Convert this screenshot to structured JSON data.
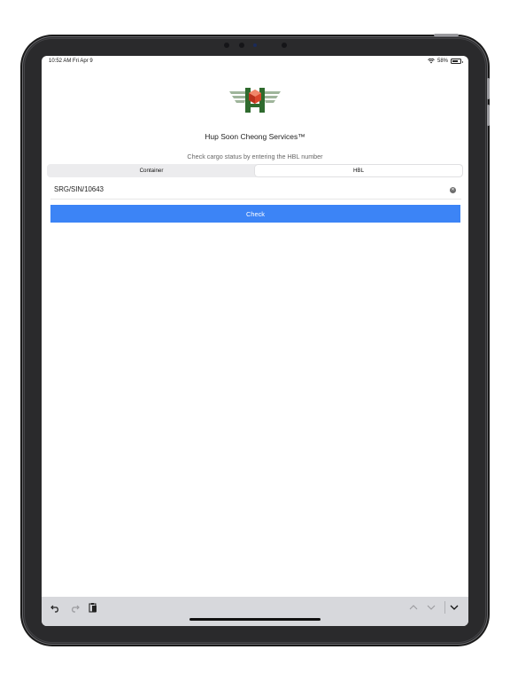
{
  "status_bar": {
    "time": "10:52 AM   Fri Apr 9",
    "battery": "58%",
    "battery_level": 0.58
  },
  "app": {
    "title": "Hup Soon Cheong Services™",
    "subtitle": "Check cargo status by entering the HBL number"
  },
  "segments": [
    {
      "label": "Container",
      "selected": false
    },
    {
      "label": "HBL",
      "selected": true
    }
  ],
  "input": {
    "value": "SRG/SIN/10643"
  },
  "check_button": {
    "label": "Check"
  },
  "colors": {
    "accent": "#3c84f6",
    "logo_green": "#2f6b2e",
    "logo_red": "#d9452b"
  },
  "keyboard_bar": {
    "icons": [
      "undo-icon",
      "redo-icon",
      "paste-icon",
      "chevron-up-icon",
      "chevron-down-icon",
      "dismiss-keyboard-icon"
    ]
  }
}
